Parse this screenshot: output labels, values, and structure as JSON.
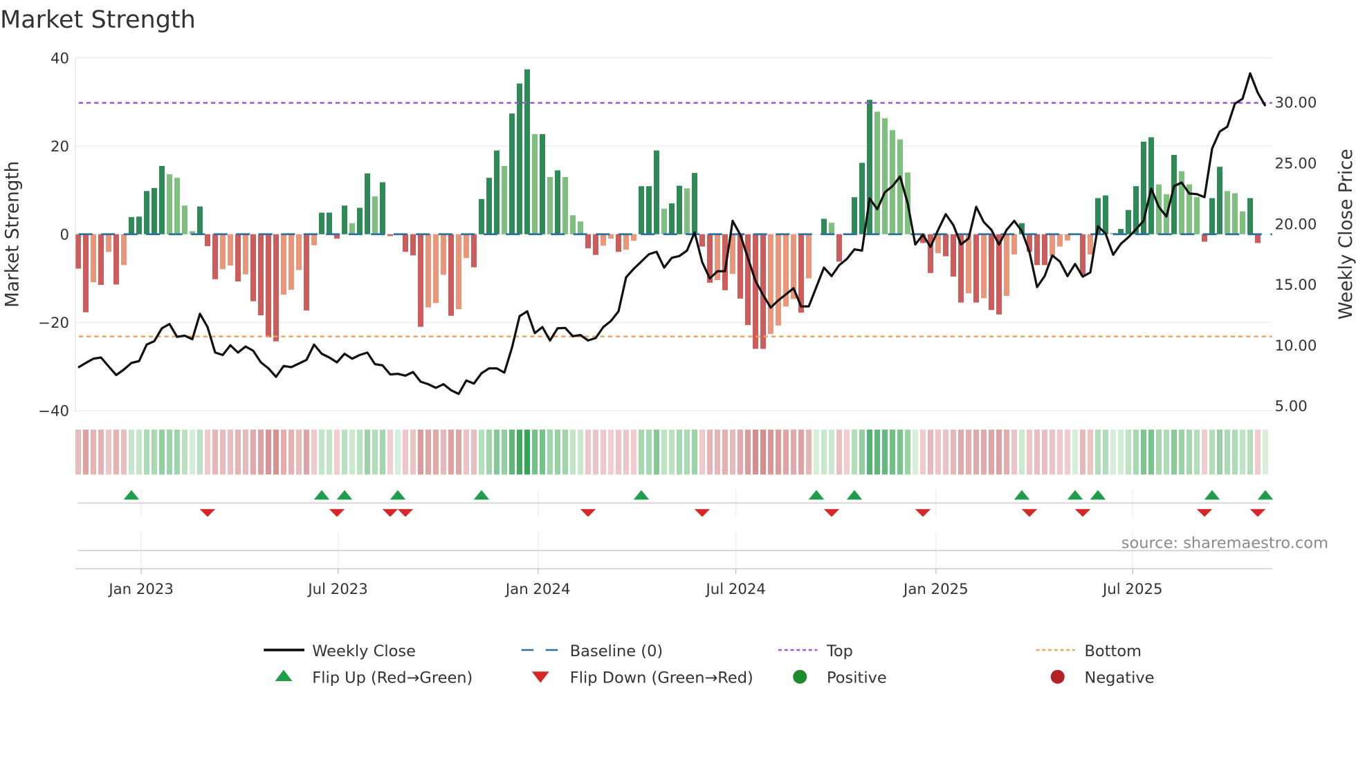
{
  "chart_data": {
    "type": "bar",
    "title": "Market Strength",
    "ylabel": "Market Strength",
    "y2label": "Weekly Close Price",
    "ylim": [
      -40,
      40
    ],
    "y2lim": [
      4.4,
      33.6
    ],
    "yticks": [
      "40",
      "20",
      "0",
      "−20",
      "−40"
    ],
    "ytick_values": [
      40,
      20,
      0,
      -20,
      -40
    ],
    "y2ticks": [
      "5.00",
      "10.00",
      "15.00",
      "20.00",
      "25.00",
      "30.00"
    ],
    "y2tick_values": [
      5,
      10,
      15,
      20,
      25,
      30
    ],
    "xticks": [
      "Jan 2023",
      "Jul 2023",
      "Jan 2024",
      "Jul 2024",
      "Jan 2025",
      "Jul 2025"
    ],
    "xtick_dates": [
      "2023-01-01",
      "2023-07-01",
      "2024-01-01",
      "2024-07-01",
      "2025-01-01",
      "2025-07-01"
    ],
    "first_week": "2022-11-04",
    "frequency": "weekly",
    "top_level": 29.8,
    "bottom_level": -23.2,
    "baseline": 0,
    "strength": [
      -7.8,
      -17.7,
      -10.9,
      -11.5,
      -4,
      -11.4,
      -7,
      3.9,
      4,
      9.8,
      10.5,
      15.5,
      13.6,
      12.8,
      6.5,
      0.7,
      6.3,
      -2.7,
      -10.2,
      -7.9,
      -7.1,
      -10.7,
      -9.1,
      -15.2,
      -18.4,
      -23.4,
      -24.3,
      -13.7,
      -12.6,
      -8.1,
      -17.3,
      -2.5,
      4.9,
      4.9,
      -1,
      6.5,
      2.5,
      6,
      13.8,
      8.6,
      11.8,
      -0.4,
      0,
      -4,
      -4.8,
      -21,
      -16.6,
      -15.6,
      -9.2,
      -18.5,
      -17,
      -5.4,
      -7.5,
      8,
      12.8,
      19,
      15.5,
      27.4,
      34.2,
      37.4,
      22.7,
      22.7,
      13,
      14.5,
      13,
      4.3,
      2.9,
      -3.2,
      -4.7,
      -2.6,
      -1,
      -4,
      -3.5,
      -1.5,
      10.9,
      10.9,
      19,
      5.8,
      7,
      11,
      10.4,
      13.9,
      -2.8,
      -11,
      -10.4,
      -12.7,
      -9,
      -14.6,
      -20.6,
      -26,
      -26,
      -22.6,
      -20.7,
      -16.4,
      -14.7,
      -17.8,
      -10,
      0,
      3.5,
      2.6,
      -6.2,
      -0.2,
      8.4,
      16.2,
      30.5,
      27.8,
      26.3,
      23.6,
      21.5,
      14,
      0,
      -2,
      -8.8,
      -4.3,
      -5,
      -9.6,
      -15.5,
      -13.4,
      -15.5,
      -14.5,
      -17.2,
      -18.2,
      -14,
      -4.6,
      2.5,
      -4,
      -7,
      -7,
      -5,
      -2.8,
      -1.4,
      0,
      -9.2,
      -4.6,
      8.2,
      8.8,
      0.3,
      1.2,
      5.5,
      10.9,
      21,
      22,
      11.3,
      9.1,
      18,
      14.3,
      11.3,
      8.4,
      -1.7,
      8.2,
      15.3,
      9.8,
      9.3,
      5.2,
      8.2,
      -2,
      0
    ],
    "weekly_close": [
      8.17,
      8.55,
      8.9,
      9.0,
      8.26,
      7.55,
      8.0,
      8.55,
      8.7,
      10.06,
      10.34,
      11.4,
      11.75,
      10.7,
      10.8,
      10.5,
      12.6,
      11.5,
      9.4,
      9.2,
      10.0,
      9.4,
      9.9,
      9.55,
      8.6,
      8.1,
      7.4,
      8.3,
      8.2,
      8.5,
      8.8,
      10.06,
      9.3,
      9.0,
      8.6,
      9.3,
      8.9,
      9.2,
      9.4,
      8.45,
      8.35,
      7.6,
      7.65,
      7.5,
      7.8,
      7.0,
      6.8,
      6.5,
      6.8,
      6.3,
      6.0,
      7.1,
      6.85,
      7.7,
      8.1,
      8.1,
      7.75,
      9.8,
      12.4,
      12.8,
      11.0,
      11.5,
      10.4,
      11.4,
      11.43,
      10.75,
      10.85,
      10.4,
      10.6,
      11.5,
      12.0,
      12.8,
      15.6,
      16.3,
      16.9,
      17.5,
      17.7,
      16.4,
      17.2,
      17.35,
      17.8,
      19.3,
      16.85,
      15.5,
      16.1,
      16.1,
      20.25,
      19.1,
      17.2,
      15.3,
      14.15,
      13.1,
      13.7,
      14.2,
      14.7,
      13.2,
      13.2,
      14.8,
      16.4,
      15.7,
      16.6,
      17.1,
      17.9,
      17.8,
      22.1,
      21.2,
      22.6,
      23.1,
      23.9,
      21.7,
      18.3,
      19.1,
      18.1,
      19.5,
      20.8,
      19.9,
      18.3,
      18.8,
      21.4,
      20.15,
      19.5,
      18.3,
      19.5,
      20.25,
      19.4,
      17.7,
      14.8,
      15.7,
      17.4,
      16.9,
      15.7,
      16.7,
      15.65,
      16.0,
      19.8,
      19.2,
      17.45,
      18.35,
      18.9,
      19.55,
      20.25,
      22.9,
      21.4,
      20.6,
      23.1,
      23.4,
      22.5,
      22.45,
      22.2,
      26.2,
      27.6,
      28.0,
      29.9,
      30.3,
      32.4,
      30.8,
      29.7
    ],
    "flip_up_weeks": [
      7,
      32,
      35,
      42,
      53,
      74,
      97,
      102,
      124,
      131,
      134,
      149,
      156
    ],
    "flip_down_weeks": [
      17,
      34,
      41,
      43,
      67,
      82,
      99,
      111,
      125,
      132,
      148,
      155
    ],
    "legend": {
      "placement": "bottom",
      "items": [
        {
          "key": "close",
          "label": "Weekly Close"
        },
        {
          "key": "baseline",
          "label": "Baseline (0)"
        },
        {
          "key": "top",
          "label": "Top"
        },
        {
          "key": "bottom",
          "label": "Bottom"
        },
        {
          "key": "flip_up",
          "label": "Flip Up (Red→Green)"
        },
        {
          "key": "flip_down",
          "label": "Flip Down (Green→Red)"
        },
        {
          "key": "positive",
          "label": "Positive"
        },
        {
          "key": "negative",
          "label": "Negative"
        }
      ]
    },
    "source": "source: sharemaestro.com",
    "grid": true
  },
  "colors": {
    "pos_rising": "#2e8b57",
    "pos_falling": "#7fbf7f",
    "neg_falling": "#cd5c5c",
    "neg_rising": "#e9967a",
    "top": "#9b59d0",
    "bottom": "#f0a35e",
    "baseline": "#2f6f9f",
    "close": "#111111",
    "flip_up": "#1e9e48",
    "flip_down": "#d62728",
    "positive": "#1e8c2e",
    "negative": "#b22222"
  }
}
